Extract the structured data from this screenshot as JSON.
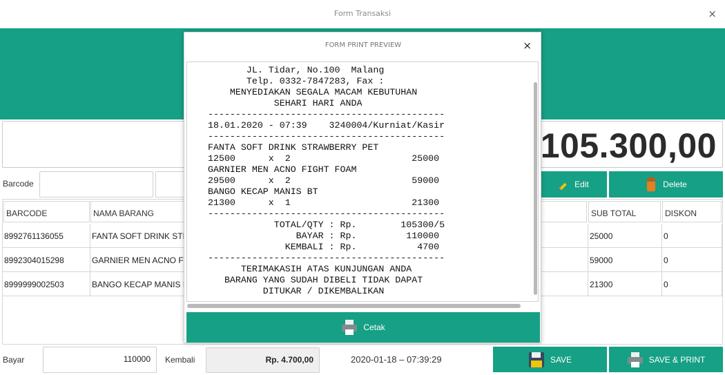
{
  "window": {
    "title": "Form Transaksi",
    "close": "×"
  },
  "total": {
    "amount": "105.300,00"
  },
  "barcode": {
    "label": "Barcode"
  },
  "toolbar": {
    "edit_label": "Edit",
    "delete_label": "Delete"
  },
  "table": {
    "headers": [
      "BARCODE",
      "NAMA BARANG",
      "SUB TOTAL",
      "DISKON"
    ],
    "rows": [
      {
        "barcode": "8992761136055",
        "nama": "FANTA SOFT DRINK STRAWBERRY PET",
        "subtotal": "25000",
        "diskon": "0"
      },
      {
        "barcode": "8992304015298",
        "nama": "GARNIER MEN ACNO FIGHT FOAM",
        "subtotal": "59000",
        "diskon": "0"
      },
      {
        "barcode": "8999999002503",
        "nama": "BANGO KECAP MANIS BT",
        "subtotal": "21300",
        "diskon": "0"
      }
    ]
  },
  "bottom": {
    "bayar_label": "Bayar",
    "bayar_value": "110000",
    "kembali_label": "Kembali",
    "kembali_value": "Rp. 4.700,00",
    "datetime": "2020-01-18  –  07:39:29",
    "save_label": "SAVE",
    "save_print_label": "SAVE & PRINT"
  },
  "modal": {
    "title": "FORM PRINT PREVIEW",
    "close": "×",
    "cetak_label": "Cetak",
    "receipt_lines": [
      "       JL. Tidar, No.100  Malang",
      "       Telp. 0332-7847283, Fax :",
      "    MENYEDIAKAN SEGALA MACAM KEBUTUHAN",
      "            SEHARI HARI ANDA",
      "-------------------------------------------",
      "18.01.2020 - 07:39    3240004/Kurniat/Kasir",
      "-------------------------------------------",
      "FANTA SOFT DRINK STRAWBERRY PET",
      "12500      x  2                      25000",
      "GARNIER MEN ACNO FIGHT FOAM",
      "29500      x  2                      59000",
      "BANGO KECAP MANIS BT",
      "21300      x  1                      21300",
      "-------------------------------------------",
      "            TOTAL/QTY : Rp.        105300/5",
      "                BAYAR : Rp.         110000",
      "              KEMBALI : Rp.           4700",
      "-------------------------------------------",
      "      TERIMAKASIH ATAS KUNJUNGAN ANDA",
      "   BARANG YANG SUDAH DIBELI TIDAK DAPAT",
      "          DITUKAR / DIKEMBALIKAN"
    ]
  },
  "colors": {
    "accent": "#16a085"
  }
}
